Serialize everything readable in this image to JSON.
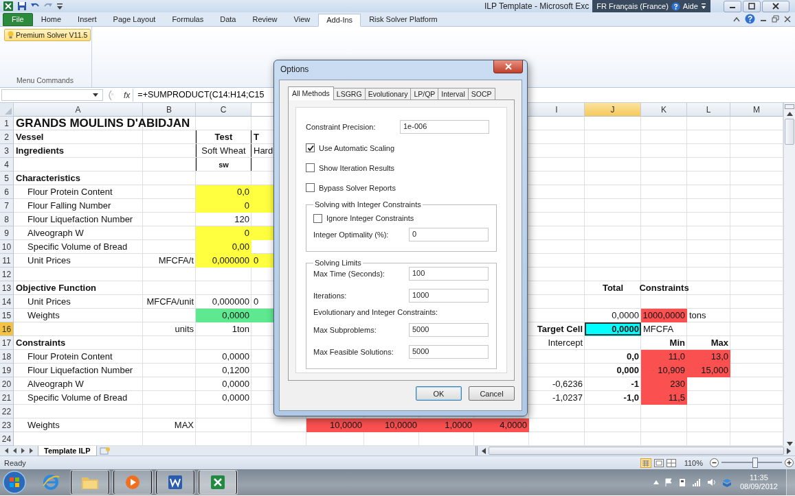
{
  "window": {
    "title": "ILP Template - Microsoft Exc"
  },
  "language_bar": {
    "language": "FR Français (France)",
    "help": "Aide"
  },
  "ribbon": {
    "tabs": [
      {
        "label": "File",
        "kind": "file",
        "selected": false
      },
      {
        "label": "Home",
        "kind": "tab",
        "selected": false
      },
      {
        "label": "Insert",
        "kind": "tab",
        "selected": false
      },
      {
        "label": "Page Layout",
        "kind": "tab",
        "selected": false
      },
      {
        "label": "Formulas",
        "kind": "tab",
        "selected": false
      },
      {
        "label": "Data",
        "kind": "tab",
        "selected": false
      },
      {
        "label": "Review",
        "kind": "tab",
        "selected": false
      },
      {
        "label": "View",
        "kind": "tab",
        "selected": false
      },
      {
        "label": "Add-Ins",
        "kind": "tab",
        "selected": true
      },
      {
        "label": "Risk Solver Platform",
        "kind": "tab",
        "selected": false
      }
    ],
    "button": "Premium Solver V11.5",
    "group_label": "Menu Commands"
  },
  "formula_bar": {
    "function_label": "fx",
    "formula": "=+SUMPRODUCT(C14:H14;C15"
  },
  "sheet": {
    "columns": [
      {
        "label": "A",
        "selected": false
      },
      {
        "label": "B",
        "selected": false
      },
      {
        "label": "C",
        "selected": false
      },
      {},
      {},
      {},
      {},
      {},
      {
        "label": "I",
        "selected": false
      },
      {
        "label": "J",
        "selected": true
      },
      {
        "label": "K",
        "selected": false
      },
      {
        "label": "L",
        "selected": false
      },
      {
        "label": "M",
        "selected": false
      }
    ],
    "rows": [
      {
        "number": "1",
        "selected": false,
        "cells": [
          {
            "text": "GRANDS MOULINS D'ABIDJAN",
            "kind": "title",
            "bold": true
          },
          {},
          {},
          {},
          {},
          {},
          {},
          {},
          {},
          {},
          {},
          {},
          {}
        ]
      },
      {
        "number": "2",
        "selected": false,
        "cells": [
          {
            "text": "Vessel",
            "kind": "text",
            "bold": true
          },
          {},
          {
            "text": "Test",
            "kind": "center",
            "bold": true,
            "boxed": true
          },
          {
            "text": "T",
            "kind": "text",
            "bold": true
          },
          {},
          {},
          {},
          {},
          {},
          {},
          {},
          {},
          {}
        ]
      },
      {
        "number": "3",
        "selected": false,
        "cells": [
          {
            "text": "Ingredients",
            "kind": "text",
            "bold": true
          },
          {},
          {
            "text": "Soft Wheat",
            "kind": "center",
            "boxed": true
          },
          {
            "text": "Hard",
            "kind": "text"
          },
          {},
          {},
          {},
          {},
          {},
          {},
          {},
          {},
          {}
        ]
      },
      {
        "number": "4",
        "selected": false,
        "cells": [
          {},
          {},
          {
            "text": "sw",
            "kind": "center",
            "bold": true,
            "small": true,
            "boxed": true
          },
          {},
          {},
          {},
          {},
          {},
          {},
          {},
          {},
          {},
          {}
        ]
      },
      {
        "number": "5",
        "selected": false,
        "cells": [
          {
            "text": "Characteristics",
            "kind": "text",
            "bold": true
          },
          {},
          {},
          {},
          {},
          {},
          {},
          {},
          {},
          {},
          {},
          {},
          {}
        ]
      },
      {
        "number": "6",
        "selected": false,
        "cells": [
          {
            "text": "Flour Protein Content",
            "kind": "sub"
          },
          {},
          {
            "text": "0,0",
            "kind": "number",
            "color": "#ffff40"
          },
          {
            "color": "#ffff40"
          },
          {},
          {},
          {},
          {},
          {},
          {},
          {},
          {},
          {}
        ]
      },
      {
        "number": "7",
        "selected": false,
        "cells": [
          {
            "text": "Flour Falling Number",
            "kind": "sub"
          },
          {},
          {
            "text": "0",
            "kind": "number",
            "color": "#ffff40"
          },
          {
            "color": "#ffff40"
          },
          {},
          {},
          {},
          {},
          {},
          {},
          {},
          {},
          {}
        ]
      },
      {
        "number": "8",
        "selected": false,
        "cells": [
          {
            "text": "Flour Liquefaction Number",
            "kind": "sub"
          },
          {},
          {
            "text": "120",
            "kind": "number"
          },
          {},
          {},
          {},
          {},
          {},
          {},
          {},
          {},
          {},
          {}
        ]
      },
      {
        "number": "9",
        "selected": false,
        "cells": [
          {
            "text": "Alveograph W",
            "kind": "sub"
          },
          {},
          {
            "text": "0",
            "kind": "number",
            "color": "#ffff40"
          },
          {
            "color": "#ffff40"
          },
          {},
          {},
          {},
          {},
          {},
          {},
          {},
          {},
          {}
        ]
      },
      {
        "number": "10",
        "selected": false,
        "cells": [
          {
            "text": "Specific Volume of Bread",
            "kind": "sub"
          },
          {},
          {
            "text": "0,00",
            "kind": "number",
            "color": "#ffff40"
          },
          {},
          {},
          {},
          {},
          {},
          {},
          {},
          {},
          {},
          {}
        ]
      },
      {
        "number": "11",
        "selected": false,
        "cells": [
          {
            "text": "Unit Prices",
            "kind": "sub"
          },
          {
            "text": "MFCFA/t",
            "kind": "number"
          },
          {
            "text": "0,000000",
            "kind": "number",
            "color": "#ffff40"
          },
          {
            "text": "0",
            "kind": "text",
            "color": "#ffff40"
          },
          {},
          {},
          {},
          {},
          {},
          {},
          {},
          {},
          {}
        ]
      },
      {
        "number": "12",
        "selected": false,
        "cells": [
          {},
          {},
          {},
          {},
          {},
          {},
          {},
          {},
          {},
          {},
          {},
          {},
          {}
        ]
      },
      {
        "number": "13",
        "selected": false,
        "cells": [
          {
            "text": "Objective Function",
            "kind": "text",
            "bold": true
          },
          {},
          {},
          {},
          {},
          {},
          {},
          {},
          {},
          {
            "text": "Total",
            "kind": "center",
            "bold": true
          },
          {
            "text": "Constraints",
            "kind": "wide",
            "bold": true
          },
          {},
          {}
        ]
      },
      {
        "number": "14",
        "selected": false,
        "cells": [
          {
            "text": "Unit Prices",
            "kind": "sub"
          },
          {
            "text": "MFCFA/unit",
            "kind": "number"
          },
          {
            "text": "0,000000",
            "kind": "number"
          },
          {
            "text": "0",
            "kind": "text"
          },
          {},
          {},
          {},
          {},
          {},
          {},
          {},
          {},
          {}
        ]
      },
      {
        "number": "15",
        "selected": false,
        "cells": [
          {
            "text": "Weights",
            "kind": "sub"
          },
          {},
          {
            "text": "0,0000",
            "kind": "number",
            "color": "#5ee890"
          },
          {
            "color": "#5ee890"
          },
          {},
          {},
          {},
          {},
          {},
          {
            "text": "0,0000",
            "kind": "number"
          },
          {
            "text": "1000,0000",
            "kind": "number",
            "color": "#fa5050"
          },
          {
            "text": "tons",
            "kind": "text"
          },
          {}
        ]
      },
      {
        "number": "16",
        "selected": true,
        "cells": [
          {},
          {
            "text": "units",
            "kind": "number"
          },
          {
            "text": "1ton",
            "kind": "number"
          },
          {},
          {},
          {},
          {},
          {},
          {
            "text": "Target Cell",
            "kind": "number",
            "bold": true
          },
          {
            "text": "0,0000",
            "kind": "number",
            "bold": true,
            "color": "#00ffff"
          },
          {
            "text": "MFCFA",
            "kind": "text"
          },
          {},
          {}
        ]
      },
      {
        "number": "17",
        "selected": false,
        "cells": [
          {
            "text": "Constraints",
            "kind": "text",
            "bold": true
          },
          {},
          {},
          {},
          {},
          {},
          {},
          {},
          {
            "text": "Intercept",
            "kind": "number"
          },
          {},
          {
            "text": "Min",
            "kind": "number",
            "bold": true
          },
          {
            "text": "Max",
            "kind": "number",
            "bold": true
          },
          {}
        ]
      },
      {
        "number": "18",
        "selected": false,
        "cells": [
          {
            "text": "Flour Protein Content",
            "kind": "sub"
          },
          {},
          {
            "text": "0,0000",
            "kind": "number"
          },
          {},
          {},
          {},
          {},
          {},
          {},
          {
            "text": "0,0",
            "kind": "number",
            "bold": true
          },
          {
            "text": "11,0",
            "kind": "number",
            "color": "#fa5050"
          },
          {
            "text": "13,0",
            "kind": "number",
            "color": "#fa5050"
          },
          {}
        ]
      },
      {
        "number": "19",
        "selected": false,
        "cells": [
          {
            "text": "Flour Liquefaction Number",
            "kind": "sub"
          },
          {},
          {
            "text": "0,1200",
            "kind": "number"
          },
          {},
          {},
          {},
          {},
          {},
          {},
          {
            "text": "0,000",
            "kind": "number",
            "bold": true
          },
          {
            "text": "10,909",
            "kind": "number",
            "color": "#fa5050"
          },
          {
            "text": "15,000",
            "kind": "number",
            "color": "#fa5050"
          },
          {}
        ]
      },
      {
        "number": "20",
        "selected": false,
        "cells": [
          {
            "text": "Alveograph W",
            "kind": "sub"
          },
          {},
          {
            "text": "0,0000",
            "kind": "number"
          },
          {},
          {},
          {},
          {},
          {},
          {
            "text": "-0,6236",
            "kind": "number"
          },
          {
            "text": "-1",
            "kind": "number",
            "bold": true
          },
          {
            "text": "230",
            "kind": "number",
            "color": "#fa5050"
          },
          {},
          {}
        ]
      },
      {
        "number": "21",
        "selected": false,
        "cells": [
          {
            "text": "Specific Volume of Bread",
            "kind": "sub"
          },
          {},
          {
            "text": "0,0000",
            "kind": "number"
          },
          {},
          {},
          {},
          {},
          {},
          {
            "text": "-1,0237",
            "kind": "number"
          },
          {
            "text": "-1,0",
            "kind": "number",
            "bold": true
          },
          {
            "text": "11,5",
            "kind": "number",
            "color": "#fa5050"
          },
          {},
          {}
        ]
      },
      {
        "number": "22",
        "selected": false,
        "cells": [
          {},
          {},
          {},
          {},
          {},
          {},
          {},
          {},
          {},
          {},
          {},
          {},
          {}
        ]
      },
      {
        "number": "23",
        "selected": false,
        "cells": [
          {
            "text": "Weights",
            "kind": "sub"
          },
          {
            "text": "MAX",
            "kind": "number"
          },
          {},
          {},
          {
            "text": "10,0000",
            "kind": "number",
            "color": "#fa5050"
          },
          {
            "text": "10,0000",
            "kind": "number",
            "color": "#fa5050"
          },
          {
            "text": "1,0000",
            "kind": "number",
            "color": "#fa5050"
          },
          {
            "text": "4,0000",
            "kind": "number",
            "color": "#fa5050"
          },
          {},
          {},
          {},
          {},
          {}
        ]
      },
      {
        "number": "24",
        "selected": false,
        "cells": [
          {},
          {},
          {},
          {},
          {},
          {},
          {},
          {},
          {},
          {},
          {},
          {},
          {}
        ]
      }
    ],
    "tab": "Template ILP"
  },
  "dialog": {
    "title": "Options",
    "tabs": [
      {
        "label": "All Methods",
        "selected": true
      },
      {
        "label": "LSGRG",
        "selected": false
      },
      {
        "label": "Evolutionary",
        "selected": false
      },
      {
        "label": "LP/QP",
        "selected": false
      },
      {
        "label": "Interval",
        "selected": false
      },
      {
        "label": "SOCP",
        "selected": false
      }
    ],
    "precision": {
      "label": "Constraint Precision:",
      "value": "1e-006"
    },
    "checkboxes": [
      {
        "label": "Use Automatic Scaling",
        "checked": true
      },
      {
        "label": "Show Iteration Results",
        "checked": false
      },
      {
        "label": "Bypass Solver Reports",
        "checked": false
      }
    ],
    "groups": [
      {
        "title": "Solving with Integer Constraints",
        "items": [
          {
            "kind": "checkbox",
            "label": "Ignore Integer Constraints",
            "checked": false
          },
          {
            "kind": "field",
            "label": "Integer Optimality (%):",
            "value": "0"
          }
        ]
      },
      {
        "title": "Solving Limits",
        "items": [
          {
            "kind": "field",
            "label": "Max Time (Seconds):",
            "value": "100"
          },
          {
            "kind": "field",
            "label": "Iterations:",
            "value": "1000"
          },
          {
            "kind": "note",
            "label": "Evolutionary and Integer Constraints:"
          },
          {
            "kind": "field",
            "label": "Max Subproblems:",
            "value": "5000"
          },
          {
            "kind": "field",
            "label": "Max Feasible Solutions:",
            "value": "5000"
          }
        ]
      }
    ],
    "buttons": [
      "OK",
      "Cancel"
    ]
  },
  "status_bar": {
    "status": "Ready",
    "zoom": "110%",
    "level": 0.55
  },
  "taskbar": {
    "time": "11:35",
    "date": "08/09/2012"
  }
}
